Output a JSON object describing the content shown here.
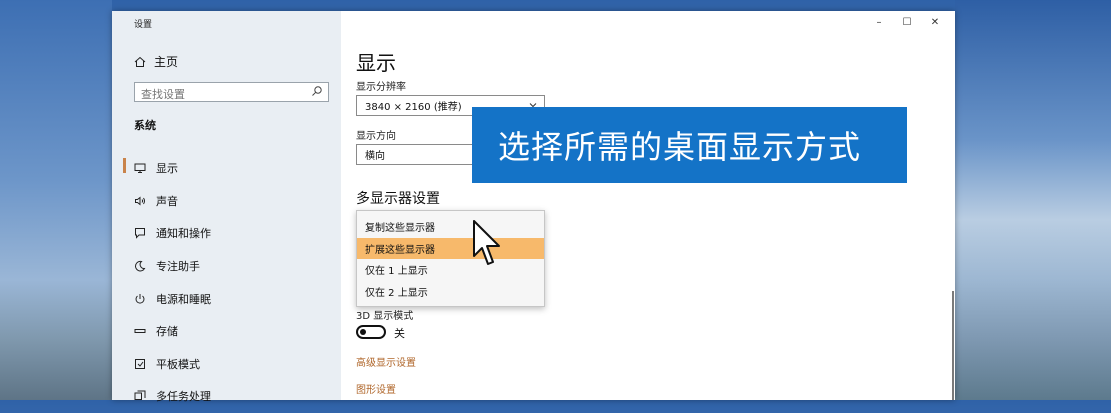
{
  "window": {
    "title": "设置"
  },
  "titlebar": {
    "minimize": "–",
    "maximize": "☐",
    "close": "✕"
  },
  "sidebar": {
    "home_label": "主页",
    "search_placeholder": "查找设置",
    "section_label": "系统",
    "items": [
      {
        "label": "显示",
        "icon": "display-icon",
        "active": true
      },
      {
        "label": "声音",
        "icon": "speaker-icon"
      },
      {
        "label": "通知和操作",
        "icon": "notification-icon"
      },
      {
        "label": "专注助手",
        "icon": "moon-icon"
      },
      {
        "label": "电源和睡眠",
        "icon": "power-icon"
      },
      {
        "label": "存储",
        "icon": "storage-icon"
      },
      {
        "label": "平板模式",
        "icon": "tablet-icon"
      },
      {
        "label": "多任务处理",
        "icon": "multitask-icon"
      }
    ]
  },
  "main": {
    "title": "显示",
    "resolution_label": "显示分辨率",
    "resolution_value": "3840 × 2160 (推荐)",
    "orientation_label": "显示方向",
    "orientation_value": "横向",
    "multi_display_title": "多显示器设置",
    "multi_display_options": [
      "复制这些显示器",
      "扩展这些显示器",
      "仅在 1 上显示",
      "仅在 2 上显示"
    ],
    "highlighted_option": "扩展这些显示器",
    "mode3d_label": "3D 显示模式",
    "mode3d_state": "关",
    "link_advanced": "高级显示设置",
    "link_graphics": "图形设置"
  },
  "overlay": {
    "banner_text": "选择所需的桌面显示方式"
  },
  "colors": {
    "accent": "#c9834a",
    "banner_bg": "#1473c7",
    "highlight": "#f7b96b",
    "link": "#b0672b"
  }
}
